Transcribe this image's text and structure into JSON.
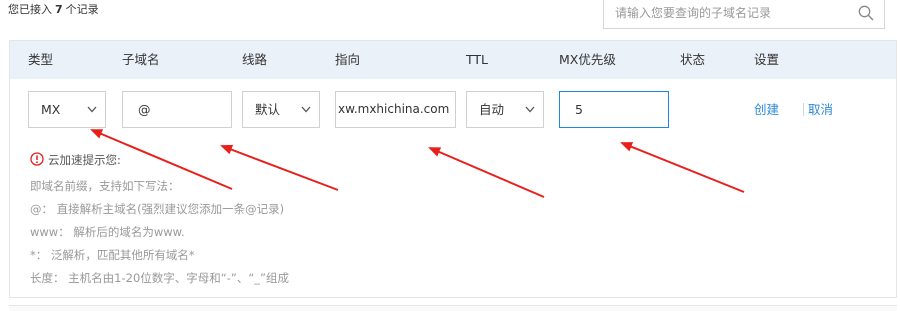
{
  "toolbar": {
    "count_prefix": "您已接入",
    "count_value": "7",
    "count_suffix": "个记录",
    "search_placeholder": "请输入您要查询的子域名记录"
  },
  "table": {
    "headers": [
      "类型",
      "子域名",
      "线路",
      "指向",
      "TTL",
      "MX优先级",
      "状态",
      "设置"
    ]
  },
  "form": {
    "type_value": "MX",
    "subdomain_value": "@",
    "line_value": "默认",
    "target_value": "xw.mxhichina.com",
    "ttl_value": "自动",
    "mx_priority_value": "5",
    "create_label": "创建",
    "cancel_label": "取消"
  },
  "tips": {
    "title": "云加速提示您:",
    "lines": [
      "即域名前缀，支持如下写法：",
      "@： 直接解析主域名(强烈建议您添加一条@记录)",
      "www： 解析后的域名为www.",
      "*： 泛解析，匹配其他所有域名*",
      "长度： 主机名由1-20位数字、字母和“-”、“_”组成"
    ]
  },
  "colors": {
    "header_bg": "#eaf1f9",
    "link": "#2f8ad4",
    "focus_border": "#1e88e5",
    "warning": "#e02020",
    "annotation_arrow": "#e8201a"
  }
}
